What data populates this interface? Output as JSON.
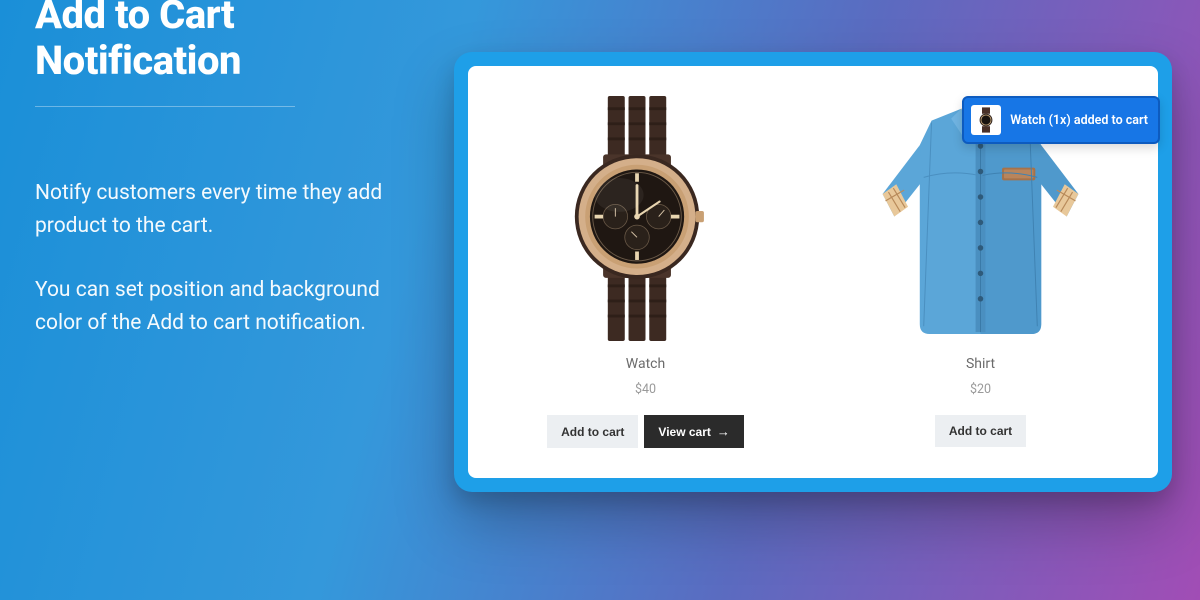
{
  "hero": {
    "title": "Add to Cart Notification",
    "desc1": "Notify customers every time they add product to the cart.",
    "desc2": "You can set position and background color of the Add to cart notification."
  },
  "products": [
    {
      "name": "Watch",
      "price": "$40",
      "add_label": "Add to cart",
      "view_label": "View cart",
      "has_view": true
    },
    {
      "name": "Shirt",
      "price": "$20",
      "add_label": "Add to cart",
      "has_view": false
    }
  ],
  "toast": {
    "text": "Watch (1x) added to cart"
  },
  "colors": {
    "frame": "#1e9fe8",
    "toast_bg": "#1776e6"
  }
}
